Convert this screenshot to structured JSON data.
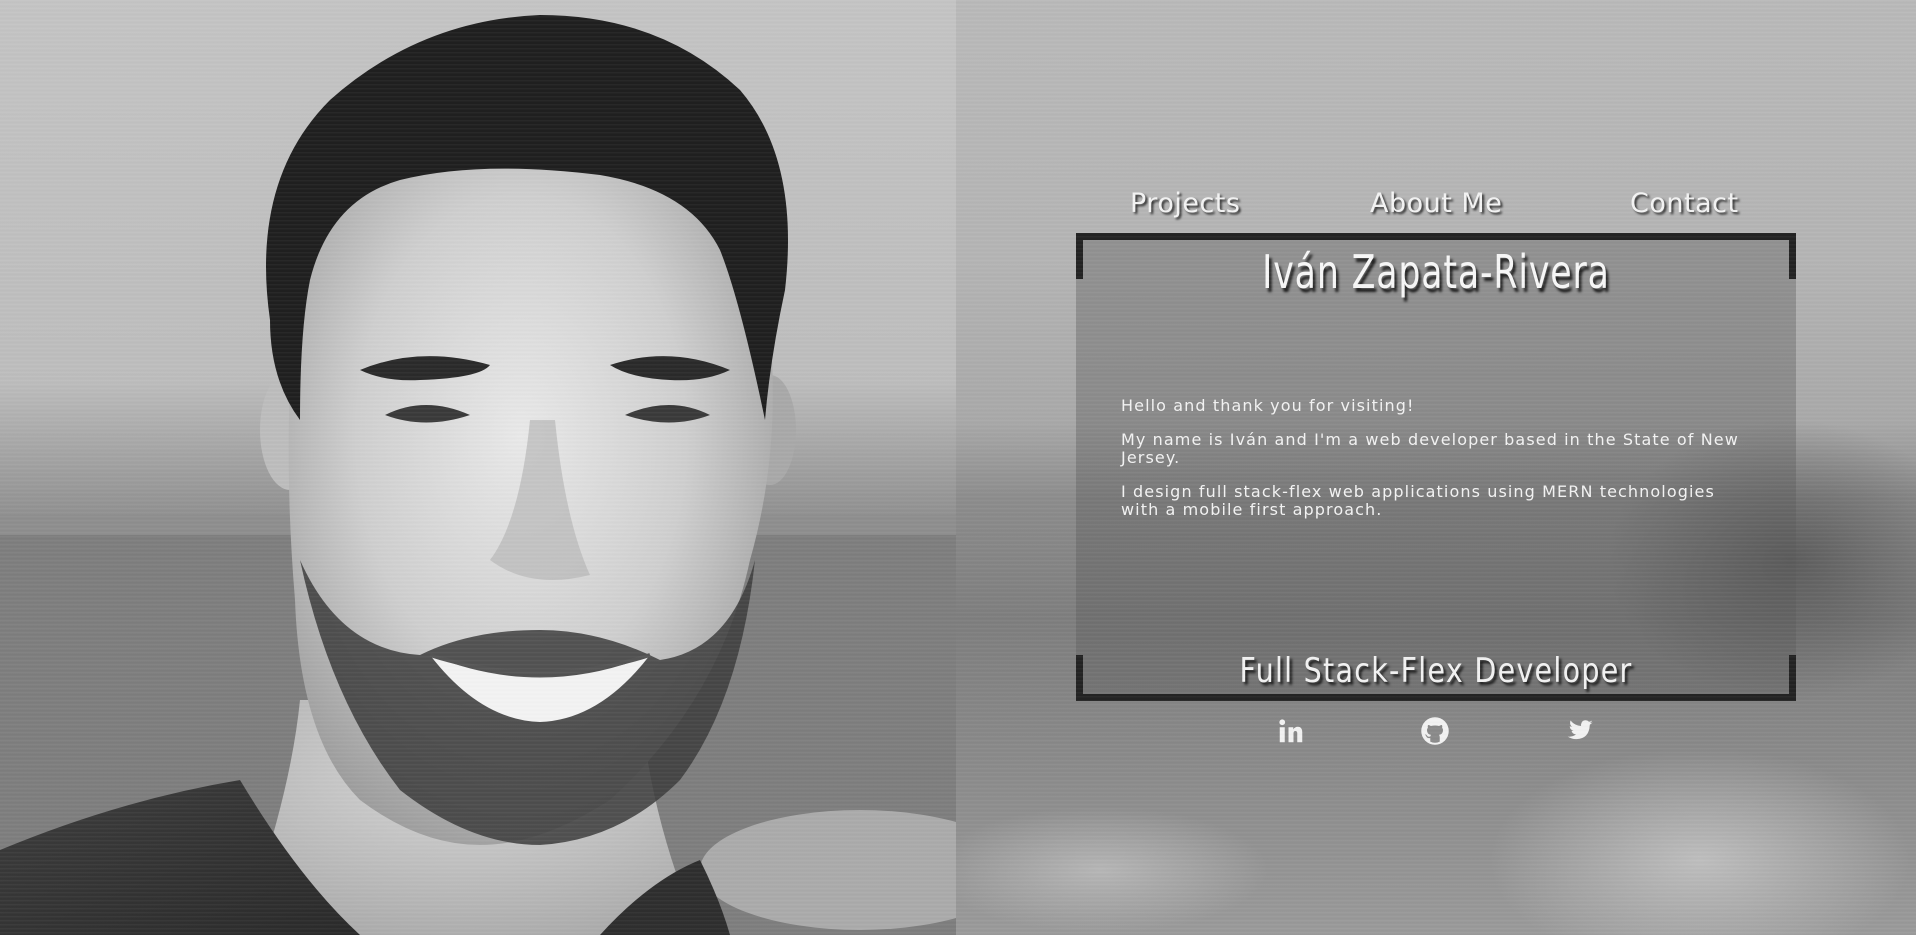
{
  "nav": {
    "items": [
      {
        "label": "Projects"
      },
      {
        "label": "About Me"
      },
      {
        "label": "Contact"
      }
    ]
  },
  "card": {
    "name": "Iván Zapata-Rivera",
    "bio": [
      "Hello and thank you for visiting!",
      "My name is Iván and I'm a web developer based in the State of New Jersey.",
      "I design full stack-flex web applications using MERN technologies with a mobile first approach."
    ],
    "role": "Full Stack-Flex Developer"
  },
  "social": {
    "icons": [
      "linkedin-icon",
      "github-icon",
      "twitter-icon"
    ]
  },
  "colors": {
    "text": "#f4f4f4",
    "frame": "#222222",
    "card_overlay": "rgba(90,90,90,0.38)"
  }
}
